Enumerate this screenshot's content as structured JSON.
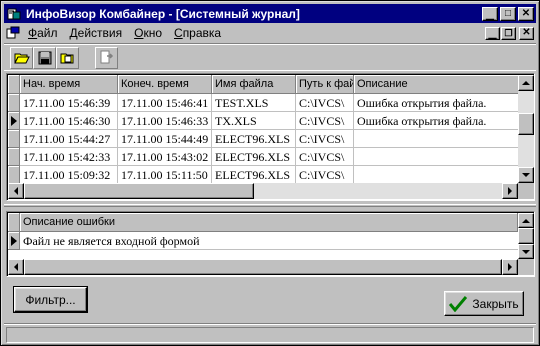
{
  "window": {
    "title": "ИнфоВизор Комбайнер - [Системный журнал]",
    "controls": {
      "minimize": "_",
      "maximize": "□",
      "close": "✕"
    }
  },
  "menu": [
    {
      "label": "Файл",
      "hotkey": "Ф",
      "rest": "айл"
    },
    {
      "label": "Действия",
      "hotkey": "Д",
      "rest": "ействия"
    },
    {
      "label": "Окно",
      "hotkey": "О",
      "rest": "кно"
    },
    {
      "label": "Справка",
      "hotkey": "С",
      "rest": "правка"
    }
  ],
  "toolbar": {
    "icons": [
      "open-folder-icon",
      "save-disk-icon",
      "open-file-icon",
      "export-icon"
    ]
  },
  "log_table": {
    "columns": [
      "Нач. время",
      "Конеч. время",
      "Имя файла",
      "Путь к фай",
      "Описание"
    ],
    "rows": [
      {
        "start": "17.11.00 15:46:39",
        "end": "17.11.00 15:46:41",
        "file": "TEST.XLS",
        "path": "C:\\IVCS\\",
        "desc": "Ошибка открытия файла.",
        "current": false
      },
      {
        "start": "17.11.00 15:46:30",
        "end": "17.11.00 15:46:33",
        "file": "TX.XLS",
        "path": "C:\\IVCS\\",
        "desc": "Ошибка открытия файла.",
        "current": true
      },
      {
        "start": "17.11.00 15:44:27",
        "end": "17.11.00 15:44:49",
        "file": "ELECT96.XLS",
        "path": "C:\\IVCS\\",
        "desc": "",
        "current": false
      },
      {
        "start": "17.11.00 15:42:33",
        "end": "17.11.00 15:43:02",
        "file": "ELECT96.XLS",
        "path": "C:\\IVCS\\",
        "desc": "",
        "current": false
      },
      {
        "start": "17.11.00 15:09:32",
        "end": "17.11.00 15:11:50",
        "file": "ELECT96.XLS",
        "path": "C:\\IVCS\\",
        "desc": "",
        "current": false
      }
    ]
  },
  "error_table": {
    "column": "Описание ошибки",
    "rows": [
      "Файл не является входной формой"
    ]
  },
  "buttons": {
    "filter": "Фильтр...",
    "close": "Закрыть"
  },
  "colors": {
    "titlebar": "#000080",
    "face": "#c0c0c0",
    "check": "#008000"
  }
}
